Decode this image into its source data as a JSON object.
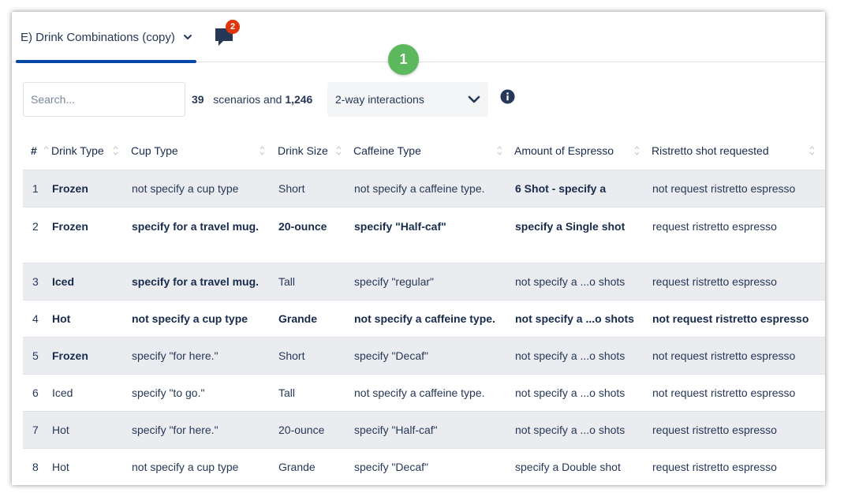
{
  "tab": {
    "title": "E) Drink Combinations (copy)",
    "comment_badge": "2"
  },
  "step_badge": "1",
  "search": {
    "placeholder": "Search...",
    "value": ""
  },
  "summary": {
    "scenario_count": "39",
    "scenarios_text": "scenarios and",
    "interaction_count": "1,246"
  },
  "interaction_select": {
    "selected": "2-way interactions"
  },
  "table": {
    "columns": [
      "#",
      "Drink Type",
      "Cup Type",
      "Drink Size",
      "Caffeine Type",
      "Amount of Espresso",
      "Ristretto shot requested"
    ],
    "rows": [
      {
        "num": "1",
        "drink_type": "Frozen",
        "cup_type": "not specify a cup type",
        "drink_size": "Short",
        "caffeine_type": "not specify a caffeine type.",
        "espresso": "6 Shot - specify a",
        "ristretto": "not request ristretto espresso"
      },
      {
        "num": "2",
        "drink_type": "Frozen",
        "cup_type": "specify for a travel mug.",
        "drink_size": "20-ounce",
        "caffeine_type": "specify \"Half-caf\"",
        "espresso": "specify a Single shot",
        "ristretto": "request ristretto espresso"
      },
      {
        "num": "3",
        "drink_type": "Iced",
        "cup_type": "specify for a travel mug.",
        "drink_size": "Tall",
        "caffeine_type": "specify \"regular\"",
        "espresso": "not specify a ...o shots",
        "ristretto": "request ristretto espresso"
      },
      {
        "num": "4",
        "drink_type": "Hot",
        "cup_type": "not specify a cup type",
        "drink_size": "Grande",
        "caffeine_type": "not specify a caffeine type.",
        "espresso": "not specify a ...o shots",
        "ristretto": "not request ristretto espresso"
      },
      {
        "num": "5",
        "drink_type": "Frozen",
        "cup_type": "specify \"for here.\"",
        "drink_size": "Short",
        "caffeine_type": "specify \"Decaf\"",
        "espresso": "not specify a ...o shots",
        "ristretto": "not request ristretto espresso"
      },
      {
        "num": "6",
        "drink_type": "Iced",
        "cup_type": "specify \"to go.\"",
        "drink_size": "Tall",
        "caffeine_type": "not specify a caffeine type.",
        "espresso": "not specify a ...o shots",
        "ristretto": "not request ristretto espresso"
      },
      {
        "num": "7",
        "drink_type": "Hot",
        "cup_type": "specify \"for here.\"",
        "drink_size": "20-ounce",
        "caffeine_type": "specify \"Half-caf\"",
        "espresso": "not specify a ...o shots",
        "ristretto": "request ristretto espresso"
      },
      {
        "num": "8",
        "drink_type": "Hot",
        "cup_type": "not specify a cup type",
        "drink_size": "Grande",
        "caffeine_type": "specify \"Decaf\"",
        "espresso": "specify a Double shot",
        "ristretto": "request ristretto espresso"
      }
    ]
  },
  "icons": {
    "tab_chevron": "chevron-down-icon",
    "comments": "comment-icon",
    "dropdown_chevron": "chevron-down-icon",
    "info": "info-icon",
    "sort": "sort-icon"
  },
  "colors": {
    "accent": "#0747a6",
    "badge_red": "#de350b",
    "step_green": "#5cb85c",
    "row_shade": "#ebecf0"
  }
}
